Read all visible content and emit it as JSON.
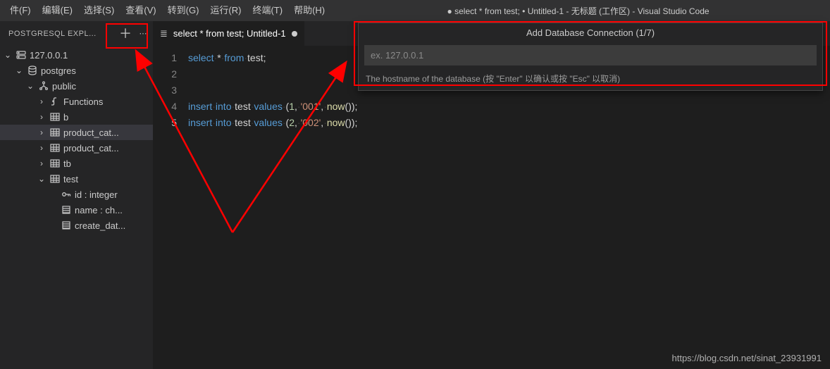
{
  "menubar": {
    "items": [
      {
        "label": "件(F)"
      },
      {
        "label": "编辑(E)"
      },
      {
        "label": "选择(S)"
      },
      {
        "label": "查看(V)"
      },
      {
        "label": "转到(G)"
      },
      {
        "label": "运行(R)"
      },
      {
        "label": "终端(T)"
      },
      {
        "label": "帮助(H)"
      }
    ],
    "title": "● select * from test; • Untitled-1 - 无标题 (工作区) - Visual Studio Code"
  },
  "sidebar": {
    "title": "POSTGRESQL EXPL...",
    "tree": {
      "server": "127.0.0.1",
      "database": "postgres",
      "schema": "public",
      "nodes": [
        {
          "label": "Functions",
          "kind": "functions",
          "expandable": true
        },
        {
          "label": "b",
          "kind": "table",
          "expandable": true
        },
        {
          "label": "product_cat...",
          "kind": "table",
          "expandable": true,
          "selected": true
        },
        {
          "label": "product_cat...",
          "kind": "table",
          "expandable": true
        },
        {
          "label": "tb",
          "kind": "table",
          "expandable": true
        },
        {
          "label": "test",
          "kind": "table",
          "expandable": true,
          "expanded": true,
          "columns": [
            {
              "label": "id : integer",
              "kind": "pk"
            },
            {
              "label": "name : ch...",
              "kind": "col"
            },
            {
              "label": "create_dat...",
              "kind": "col"
            }
          ]
        }
      ]
    }
  },
  "editor": {
    "tab": {
      "label": "select * from test;  Untitled-1"
    },
    "lines_numbers": [
      "1",
      "2",
      "3",
      "4",
      "5"
    ],
    "current_line_index": 4,
    "code": {
      "l1": {
        "a": "select",
        "b": " * ",
        "c": "from",
        "d": " test;"
      },
      "l4": {
        "a": "insert",
        "b": "into",
        "c": " test ",
        "d": "values",
        "e": " (",
        "n1": "1",
        "f": ", ",
        "s1": "'001'",
        "g": ", ",
        "fn": "now",
        "h": "());"
      },
      "l5": {
        "a": "insert",
        "b": "into",
        "c": " test ",
        "d": "values",
        "e": " (",
        "n1": "2",
        "f": ", ",
        "s1": "'002'",
        "g": ", ",
        "fn": "now",
        "h": "());"
      }
    }
  },
  "quickinput": {
    "title": "Add Database Connection (1/7)",
    "placeholder": "ex. 127.0.0.1",
    "hint": "The hostname of the database (按 \"Enter\" 以确认或按 \"Esc\" 以取消)"
  },
  "watermark": "https://blog.csdn.net/sinat_23931991"
}
